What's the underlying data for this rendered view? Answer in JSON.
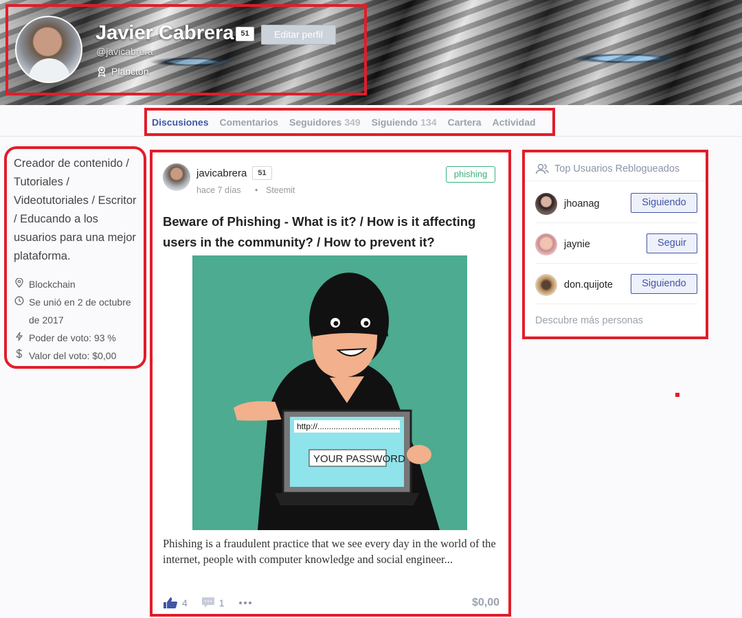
{
  "profile": {
    "name": "Javier Cabrera",
    "reputation": "51",
    "edit_label": "Editar perfil",
    "handle": "@javicabrera",
    "rank": "Plancton"
  },
  "tabs": [
    {
      "label": "Discusiones",
      "count": ""
    },
    {
      "label": "Comentarios",
      "count": ""
    },
    {
      "label": "Seguidores",
      "count": "349"
    },
    {
      "label": "Siguiendo",
      "count": "134"
    },
    {
      "label": "Cartera",
      "count": ""
    },
    {
      "label": "Actividad",
      "count": ""
    }
  ],
  "sidebar": {
    "bio": "Creador de contenido / Tutoriales / Videotutoriales / Escritor / Educando a los usuarios para una mejor plataforma.",
    "location": "Blockchain",
    "joined": "Se unió en 2 de octubre de 2017",
    "voting_power": "Poder de voto: 93 %",
    "vote_value": "Valor del voto: $0,00"
  },
  "post": {
    "author": "javicabrera",
    "reputation": "51",
    "time": "hace 7 días",
    "separator": "•",
    "source": "Steemit",
    "tag": "phishing",
    "title": "Beware of Phishing - What is it? / How is it affecting users in the community? / How to prevent it?",
    "image": {
      "url_text": "http://....................................",
      "password_text": "YOUR PASSWORD"
    },
    "excerpt": " Phishing is a  fraudulent practice that we see every day in the world of the internet,  people with computer knowledge and social engineer...",
    "votes": "4",
    "comments": "1",
    "payout": "$0,00"
  },
  "right_panel": {
    "title": "Top Usuarios Reblogueados",
    "users": [
      {
        "name": "jhoanag",
        "button": "Siguiendo"
      },
      {
        "name": "jaynie",
        "button": "Seguir"
      },
      {
        "name": "don.quijote",
        "button": "Siguiendo"
      }
    ],
    "discover_label": "Descubre más personas"
  },
  "colors": {
    "accent": "#4156a5",
    "highlight_border": "#e11d2a",
    "tag_green": "#3ab27a",
    "image_bg": "#4cab90"
  }
}
